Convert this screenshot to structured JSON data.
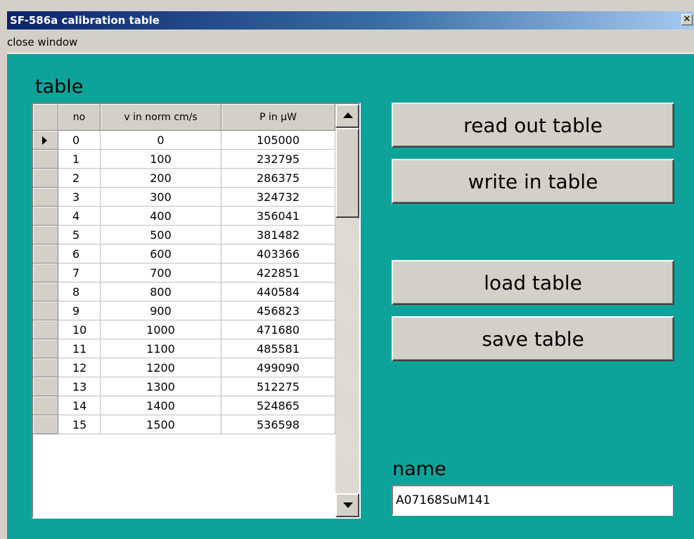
{
  "window": {
    "title": "SF-586a calibration table",
    "close_glyph": "✕"
  },
  "menu": {
    "items": [
      "close window"
    ]
  },
  "table_section": {
    "heading": "table",
    "columns": [
      "no",
      "v in norm cm/s",
      "P in µW"
    ],
    "selected_row": 0,
    "rows": [
      [
        "0",
        "0",
        "105000"
      ],
      [
        "1",
        "100",
        "232795"
      ],
      [
        "2",
        "200",
        "286375"
      ],
      [
        "3",
        "300",
        "324732"
      ],
      [
        "4",
        "400",
        "356041"
      ],
      [
        "5",
        "500",
        "381482"
      ],
      [
        "6",
        "600",
        "403366"
      ],
      [
        "7",
        "700",
        "422851"
      ],
      [
        "8",
        "800",
        "440584"
      ],
      [
        "9",
        "900",
        "456823"
      ],
      [
        "10",
        "1000",
        "471680"
      ],
      [
        "11",
        "1100",
        "485581"
      ],
      [
        "12",
        "1200",
        "499090"
      ],
      [
        "13",
        "1300",
        "512275"
      ],
      [
        "14",
        "1400",
        "524865"
      ],
      [
        "15",
        "1500",
        "536598"
      ]
    ]
  },
  "actions": {
    "read_out": "read out table",
    "write_in": "write in table",
    "load": "load table",
    "save": "save table"
  },
  "name_section": {
    "heading": "name",
    "value": "A07168SuM141"
  },
  "colors": {
    "client_background": "#0ea39a",
    "titlebar_start": "#0a246a",
    "titlebar_end": "#a6caf0",
    "button_face": "#d4d0c8"
  }
}
